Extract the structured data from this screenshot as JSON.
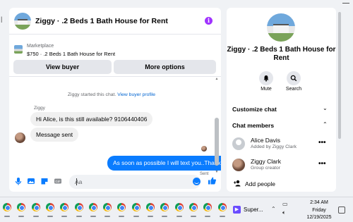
{
  "chat": {
    "title": "Ziggy · .2 Beds 1 Bath House for Rent",
    "marketplace_label": "Marketplace",
    "listing": "$750 · .2 Beds 1 Bath House for Rent",
    "view_buyer": "View buyer",
    "more_options": "More options",
    "system_message": "Ziggy started this chat.",
    "view_buyer_profile": "View buyer profile",
    "sender_name": "Ziggy",
    "incoming_messages": [
      "Hi Alice, is this still available? 9106440406",
      "Message sent"
    ],
    "outgoing_message": "As soon as possible I will text you..Thanks",
    "sent_status": "Sent",
    "input_placeholder": "Aa"
  },
  "info": {
    "title": "Ziggy · .2 Beds 1 Bath House for Rent",
    "mute_label": "Mute",
    "search_label": "Search",
    "customize_chat": "Customize chat",
    "chat_members": "Chat members",
    "members": [
      {
        "name": "Alice Davis",
        "subtitle": "Added by Ziggy Clark"
      },
      {
        "name": "Ziggy Clark",
        "subtitle": "Group creator"
      }
    ],
    "add_people": "Add people"
  },
  "taskbar": {
    "super_label": "Super...",
    "time": "2:34 AM",
    "day": "Friday",
    "date": "12/19/2025"
  },
  "colors": {
    "accent": "#0a7cff",
    "info_icon": "#a033ff",
    "page_bg": "#f0f2f5"
  },
  "icons": [
    "info-icon",
    "microphone-icon",
    "photo-icon",
    "sticker-icon",
    "gif-icon",
    "emoji-icon",
    "thumbs-up-icon",
    "bell-icon",
    "search-icon",
    "chevron-down-icon",
    "chevron-up-icon",
    "more-icon",
    "add-person-icon"
  ]
}
